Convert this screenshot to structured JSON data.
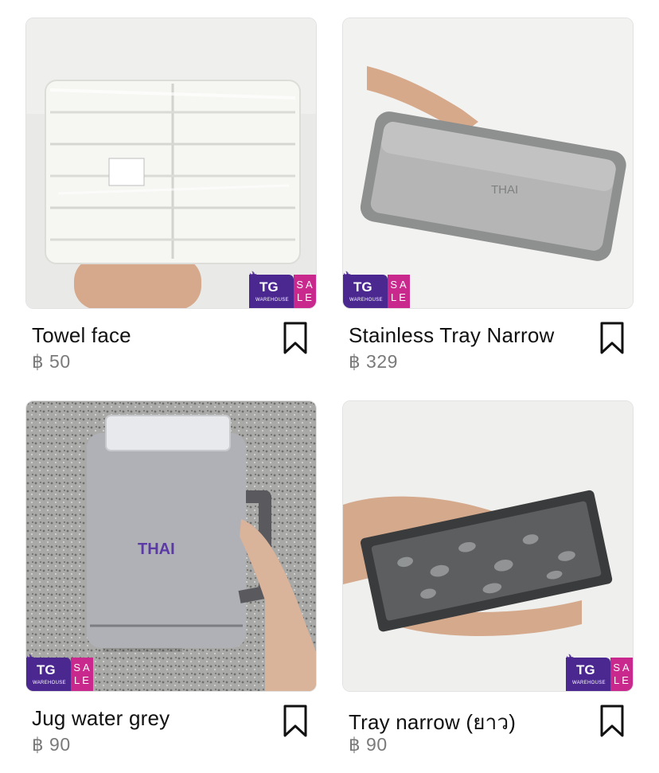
{
  "products": [
    {
      "title": "Towel face",
      "price": "฿ 50"
    },
    {
      "title": "Stainless Tray Narrow",
      "price": "฿ 329"
    },
    {
      "title": "Jug water grey",
      "price": "฿ 90"
    },
    {
      "title": "Tray narrow (ยาว)",
      "price": "฿ 90"
    }
  ],
  "badge": {
    "brand": "TG",
    "subtitle": "WAREHOUSE",
    "sale_text": "SALE",
    "colors": {
      "primary": "#4b2890",
      "accent": "#c9288d"
    }
  },
  "product_brand_mark": "THAI",
  "icons": {
    "save": "bookmark-icon",
    "badge_plane": "plane-icon"
  }
}
